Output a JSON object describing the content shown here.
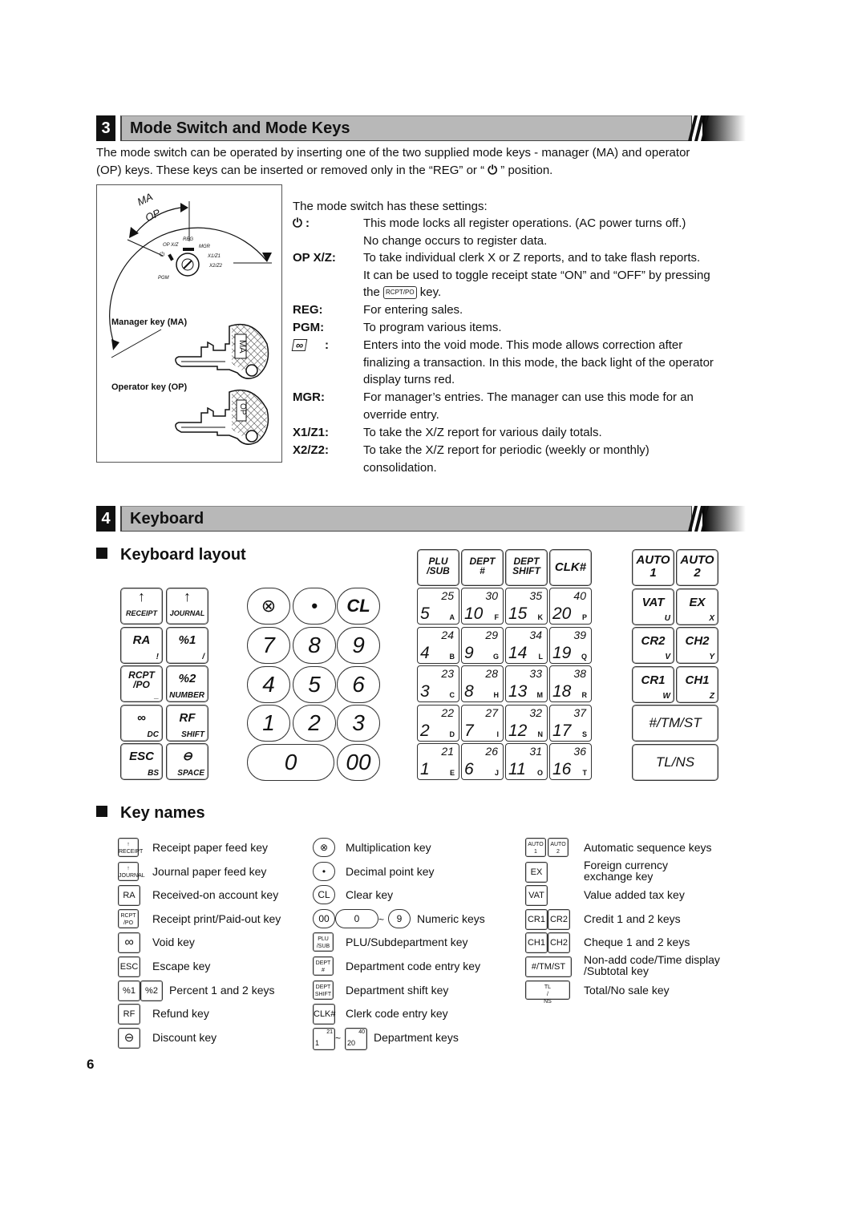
{
  "section3": {
    "number": "3",
    "title": "Mode Switch and Mode Keys",
    "intro_line1": "The mode switch can be operated by inserting one of the two supplied mode keys - manager (MA) and operator",
    "intro_line2_a": "(OP) keys.  These keys can be inserted or removed only in the “REG” or “ ",
    "intro_line2_icon": "⏻",
    "intro_line2_b": " ” position.",
    "diagram": {
      "ma_label": "MA",
      "op_label": "OP",
      "positions": [
        "OP X/Z",
        "REG",
        "MGR",
        "X1/Z1",
        "X2/Z2",
        "PGM"
      ],
      "power_icon": "⏻",
      "manager_key_label": "Manager key (MA)",
      "operator_key_label": "Operator key (OP)",
      "manager_key_text": "MA",
      "operator_key_text": "OP"
    },
    "settings_intro": "The mode switch has these settings:",
    "settings": [
      {
        "label": "⏻ :",
        "lines": [
          "This mode locks all register operations. (AC power turns off.)",
          "No change occurs to register data."
        ]
      },
      {
        "label": "OP X/Z:",
        "lines": [
          "To take individual clerk X or Z reports, and to take flash reports.",
          "It can be used to toggle receipt state “ON” and “OFF” by pressing"
        ],
        "line3_a": "the",
        "line3_key": "RCPT/PO",
        "line3_b": "key."
      },
      {
        "label": "REG:",
        "lines": [
          "For entering sales."
        ]
      },
      {
        "label": "PGM:",
        "lines": [
          "To program various items."
        ]
      },
      {
        "label": ":",
        "lines": [
          "Enters into the void mode.  This mode allows correction after",
          "finalizing a transaction. In this mode, the back light of the operator",
          "display turns red."
        ]
      },
      {
        "label": "MGR:",
        "lines": [
          "For manager’s entries.  The manager can use this mode for an",
          "override entry."
        ]
      },
      {
        "label": "X1/Z1:",
        "lines": [
          "To take the X/Z report for various daily totals."
        ]
      },
      {
        "label": "X2/Z2:",
        "lines": [
          "To take the X/Z report for periodic (weekly or monthly)",
          "consolidation."
        ]
      }
    ]
  },
  "section4": {
    "number": "4",
    "title": "Keyboard",
    "layout_heading": "Keyboard layout",
    "left_keys": [
      {
        "main": "↑",
        "sub": "RECEIPT"
      },
      {
        "main": "↑",
        "sub": "JOURNAL"
      },
      {
        "main": "RA",
        "sub": "!"
      },
      {
        "main": "%1",
        "sub": "/"
      },
      {
        "main": "RCPT /PO",
        "sub": "_"
      },
      {
        "main": "%2",
        "sub": "NUMBER"
      },
      {
        "main": "∞",
        "sub": "DC"
      },
      {
        "main": "RF",
        "sub": "SHIFT"
      },
      {
        "main": "ESC",
        "sub": "BS"
      },
      {
        "main": "⊖",
        "sub": "SPACE"
      }
    ],
    "numpad": [
      "⊗",
      "•",
      "CL",
      "7",
      "8",
      "9",
      "4",
      "5",
      "6",
      "1",
      "2",
      "3",
      "0",
      "00"
    ],
    "func_keys": [
      "PLU /SUB",
      "DEPT #",
      "DEPT SHIFT",
      "CLK#"
    ],
    "dept_rows": [
      [
        {
          "lo": "5",
          "hi": "25",
          "al": "A"
        },
        {
          "lo": "10",
          "hi": "30",
          "al": "F"
        },
        {
          "lo": "15",
          "hi": "35",
          "al": "K"
        },
        {
          "lo": "20",
          "hi": "40",
          "al": "P"
        }
      ],
      [
        {
          "lo": "4",
          "hi": "24",
          "al": "B"
        },
        {
          "lo": "9",
          "hi": "29",
          "al": "G"
        },
        {
          "lo": "14",
          "hi": "34",
          "al": "L"
        },
        {
          "lo": "19",
          "hi": "39",
          "al": "Q"
        }
      ],
      [
        {
          "lo": "3",
          "hi": "23",
          "al": "C"
        },
        {
          "lo": "8",
          "hi": "28",
          "al": "H"
        },
        {
          "lo": "13",
          "hi": "33",
          "al": "M"
        },
        {
          "lo": "18",
          "hi": "38",
          "al": "R"
        }
      ],
      [
        {
          "lo": "2",
          "hi": "22",
          "al": "D"
        },
        {
          "lo": "7",
          "hi": "27",
          "al": "I"
        },
        {
          "lo": "12",
          "hi": "32",
          "al": "N"
        },
        {
          "lo": "17",
          "hi": "37",
          "al": "S"
        }
      ],
      [
        {
          "lo": "1",
          "hi": "21",
          "al": "E"
        },
        {
          "lo": "6",
          "hi": "26",
          "al": "J"
        },
        {
          "lo": "11",
          "hi": "31",
          "al": "O"
        },
        {
          "lo": "16",
          "hi": "36",
          "al": "T"
        }
      ]
    ],
    "right_keys": [
      {
        "main": "AUTO 1",
        "sub": ""
      },
      {
        "main": "AUTO 2",
        "sub": ""
      },
      {
        "main": "VAT",
        "sub": "U"
      },
      {
        "main": "EX",
        "sub": "X"
      },
      {
        "main": "CR2",
        "sub": "V"
      },
      {
        "main": "CH2",
        "sub": "Y"
      },
      {
        "main": "CR1",
        "sub": "W"
      },
      {
        "main": "CH1",
        "sub": "Z"
      }
    ],
    "wide_keys": [
      "#/TM/ST",
      "TL/NS"
    ],
    "names_heading": "Key names",
    "key_names": {
      "col1": [
        {
          "keys": [
            "↑ RECEIPT"
          ],
          "desc": "Receipt paper feed key"
        },
        {
          "keys": [
            "↑ JOURNAL"
          ],
          "desc": "Journal paper feed key"
        },
        {
          "keys": [
            "RA"
          ],
          "desc": "Received-on account key"
        },
        {
          "keys": [
            "RCPT /PO"
          ],
          "desc": "Receipt print/Paid-out key"
        },
        {
          "keys": [
            "∞"
          ],
          "desc": "Void key"
        },
        {
          "keys": [
            "ESC"
          ],
          "desc": "Escape key"
        },
        {
          "keys": [
            "%1",
            "%2"
          ],
          "desc": "Percent 1 and 2 keys"
        },
        {
          "keys": [
            "RF"
          ],
          "desc": "Refund key"
        },
        {
          "keys": [
            "⊖"
          ],
          "desc": "Discount key"
        }
      ],
      "col2": [
        {
          "keys": [
            "⊗"
          ],
          "desc": "Multiplication key"
        },
        {
          "keys": [
            "•"
          ],
          "desc": "Decimal point key"
        },
        {
          "keys": [
            "CL"
          ],
          "desc": "Clear key"
        },
        {
          "keys": [
            "00",
            "0",
            "~",
            "9"
          ],
          "desc": "Numeric keys"
        },
        {
          "keys": [
            "PLU /SUB"
          ],
          "desc": "PLU/Subdepartment key"
        },
        {
          "keys": [
            "DEPT #"
          ],
          "desc": "Department code entry key"
        },
        {
          "keys": [
            "DEPT SHIFT"
          ],
          "desc": "Department shift key"
        },
        {
          "keys": [
            "CLK#"
          ],
          "desc": "Clerk code entry key"
        },
        {
          "keys": [
            "1 21",
            "~",
            "20 40"
          ],
          "desc": "Department keys"
        }
      ],
      "col3": [
        {
          "keys": [
            "AUTO 1",
            "AUTO 2"
          ],
          "desc": "Automatic sequence keys"
        },
        {
          "keys": [
            "EX"
          ],
          "desc": "Foreign currency exchange key",
          "desc_lines": [
            "Foreign currency",
            "exchange key"
          ]
        },
        {
          "keys": [
            "VAT"
          ],
          "desc": "Value added tax key"
        },
        {
          "keys": [
            "CR1",
            "CR2"
          ],
          "desc": "Credit 1 and 2 keys"
        },
        {
          "keys": [
            "CH1",
            "CH2"
          ],
          "desc": "Cheque 1 and 2 keys"
        },
        {
          "keys": [
            "#/TM/ST"
          ],
          "desc": "Non-add code/Time display /Subtotal key",
          "desc_lines": [
            "Non-add code/Time display",
            "/Subtotal key"
          ]
        },
        {
          "keys": [
            "TL / NS"
          ],
          "desc": "Total/No sale key"
        }
      ]
    }
  },
  "page_number": "6"
}
